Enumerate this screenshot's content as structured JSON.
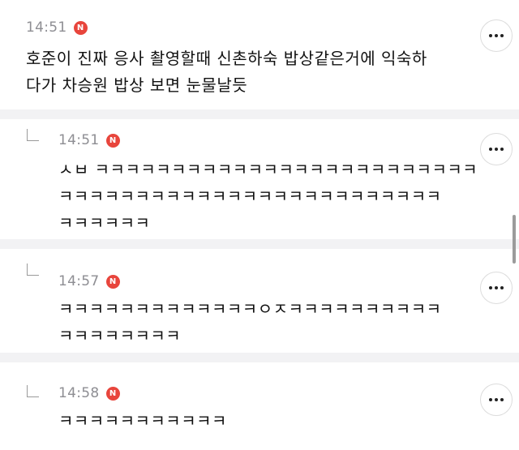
{
  "comments": [
    {
      "time": "14:51",
      "badge": "N",
      "lines": [
        "호준이 진짜 응사 촬영할때 신촌하숙 밥상같은거에 익숙하",
        "다가 차승원 밥상 보면 눈물날듯"
      ]
    },
    {
      "time": "14:51",
      "badge": "N",
      "lines": [
        "ㅅㅂ ㅋㅋㅋㅋㅋㅋㅋㅋㅋㅋㅋㅋㅋㅋㅋㅋㅋㅋㅋㅋㅋㅋㅋㅋㅋ",
        "ㅋㅋㅋㅋㅋㅋㅋㅋㅋㅋㅋㅋㅋㅋㅋㅋㅋㅋㅋㅋㅋㅋㅋㅋㅋ",
        "ㅋㅋㅋㅋㅋㅋ"
      ]
    },
    {
      "time": "14:57",
      "badge": "N",
      "lines": [
        "ㅋㅋㅋㅋㅋㅋㅋㅋㅋㅋㅋㅋㅋㅇㅈㅋㅋㅋㅋㅋㅋㅋㅋㅋㅋ",
        "ㅋㅋㅋㅋㅋㅋㅋㅋ"
      ]
    },
    {
      "time": "14:58",
      "badge": "N",
      "lines": [
        "ㅋㅋㅋㅋㅋㅋㅋㅋㅋㅋㅋ"
      ]
    }
  ],
  "icons": {
    "more": "more-horizontal-icon",
    "reply": "reply-arrow-icon",
    "new": "new-badge-icon"
  },
  "colors": {
    "badge": "#e8453c",
    "divider": "#f2f2f4",
    "time": "#8e8e93"
  }
}
